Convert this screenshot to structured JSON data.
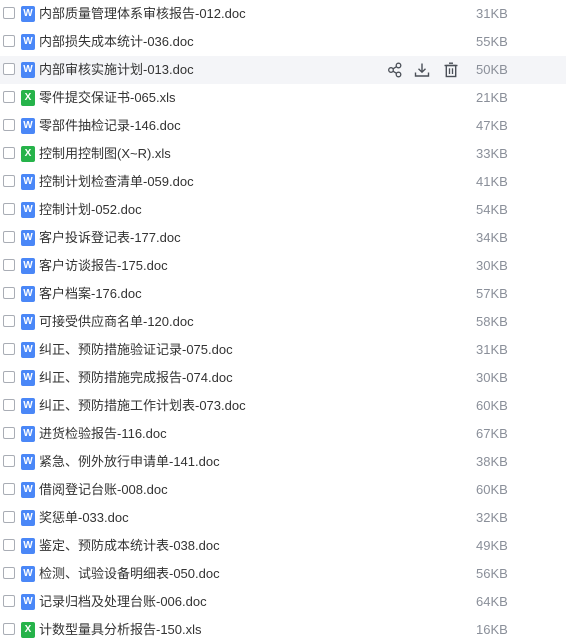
{
  "files": [
    {
      "name": "内部质量管理体系审核报告-012.doc",
      "size": "31KB",
      "type": "doc",
      "icon": "word-file-icon",
      "icon_letter": "W"
    },
    {
      "name": "内部损失成本统计-036.doc",
      "size": "55KB",
      "type": "doc",
      "icon": "word-file-icon",
      "icon_letter": "W"
    },
    {
      "name": "内部审核实施计划-013.doc",
      "size": "50KB",
      "type": "doc",
      "icon": "word-file-icon",
      "icon_letter": "W",
      "hovered": true
    },
    {
      "name": "零件提交保证书-065.xls",
      "size": "21KB",
      "type": "xls",
      "icon": "excel-file-icon",
      "icon_letter": "X"
    },
    {
      "name": "零部件抽检记录-146.doc",
      "size": "47KB",
      "type": "doc",
      "icon": "word-file-icon",
      "icon_letter": "W"
    },
    {
      "name": "控制用控制图(X~R).xls",
      "size": "33KB",
      "type": "xls",
      "icon": "excel-file-icon",
      "icon_letter": "X"
    },
    {
      "name": "控制计划检查清单-059.doc",
      "size": "41KB",
      "type": "doc",
      "icon": "word-file-icon",
      "icon_letter": "W"
    },
    {
      "name": "控制计划-052.doc",
      "size": "54KB",
      "type": "doc",
      "icon": "word-file-icon",
      "icon_letter": "W"
    },
    {
      "name": "客户投诉登记表-177.doc",
      "size": "34KB",
      "type": "doc",
      "icon": "word-file-icon",
      "icon_letter": "W"
    },
    {
      "name": "客户访谈报告-175.doc",
      "size": "30KB",
      "type": "doc",
      "icon": "word-file-icon",
      "icon_letter": "W"
    },
    {
      "name": "客户档案-176.doc",
      "size": "57KB",
      "type": "doc",
      "icon": "word-file-icon",
      "icon_letter": "W"
    },
    {
      "name": "可接受供应商名单-120.doc",
      "size": "58KB",
      "type": "doc",
      "icon": "word-file-icon",
      "icon_letter": "W"
    },
    {
      "name": "纠正、预防措施验证记录-075.doc",
      "size": "31KB",
      "type": "doc",
      "icon": "word-file-icon",
      "icon_letter": "W"
    },
    {
      "name": "纠正、预防措施完成报告-074.doc",
      "size": "30KB",
      "type": "doc",
      "icon": "word-file-icon",
      "icon_letter": "W"
    },
    {
      "name": "纠正、预防措施工作计划表-073.doc",
      "size": "60KB",
      "type": "doc",
      "icon": "word-file-icon",
      "icon_letter": "W"
    },
    {
      "name": "进货检验报告-116.doc",
      "size": "67KB",
      "type": "doc",
      "icon": "word-file-icon",
      "icon_letter": "W"
    },
    {
      "name": "紧急、例外放行申请单-141.doc",
      "size": "38KB",
      "type": "doc",
      "icon": "word-file-icon",
      "icon_letter": "W"
    },
    {
      "name": "借阅登记台账-008.doc",
      "size": "60KB",
      "type": "doc",
      "icon": "word-file-icon",
      "icon_letter": "W"
    },
    {
      "name": "奖惩单-033.doc",
      "size": "32KB",
      "type": "doc",
      "icon": "word-file-icon",
      "icon_letter": "W"
    },
    {
      "name": "鉴定、预防成本统计表-038.doc",
      "size": "49KB",
      "type": "doc",
      "icon": "word-file-icon",
      "icon_letter": "W"
    },
    {
      "name": "检测、试验设备明细表-050.doc",
      "size": "56KB",
      "type": "doc",
      "icon": "word-file-icon",
      "icon_letter": "W"
    },
    {
      "name": "记录归档及处理台账-006.doc",
      "size": "64KB",
      "type": "doc",
      "icon": "word-file-icon",
      "icon_letter": "W"
    },
    {
      "name": "计数型量具分析报告-150.xls",
      "size": "16KB",
      "type": "xls",
      "icon": "excel-file-icon",
      "icon_letter": "X"
    }
  ],
  "hover_actions": [
    {
      "name": "share-icon",
      "label": "share"
    },
    {
      "name": "download-icon",
      "label": "download"
    },
    {
      "name": "delete-icon",
      "label": "delete"
    }
  ],
  "colors": {
    "word_icon": "#4a87f7",
    "excel_icon": "#26b34a",
    "hover_row": "#f4f5f8",
    "name_text": "#333333",
    "size_text": "#8a8f99",
    "action_icon": "#4a4f57"
  }
}
